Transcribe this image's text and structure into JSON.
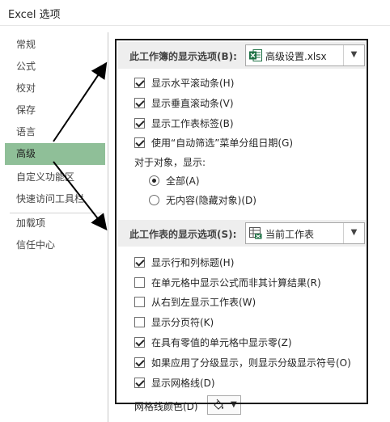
{
  "window": {
    "title": "Excel 选项"
  },
  "sidebar": {
    "items": [
      {
        "label": "常规"
      },
      {
        "label": "公式"
      },
      {
        "label": "校对"
      },
      {
        "label": "保存"
      },
      {
        "label": "语言"
      },
      {
        "label": "高级",
        "selected": true
      },
      {
        "label": "自定义功能区"
      },
      {
        "label": "快速访问工具栏"
      },
      {
        "label": "加载项"
      },
      {
        "label": "信任中心"
      }
    ]
  },
  "workbook_section": {
    "header": "此工作簿的显示选项(B):",
    "dropdown_value": "高级设置.xlsx",
    "file_icon": "excel-file-icon",
    "options": [
      {
        "label": "显示水平滚动条(H)",
        "checked": true
      },
      {
        "label": "显示垂直滚动条(V)",
        "checked": true
      },
      {
        "label": "显示工作表标签(B)",
        "checked": true
      },
      {
        "label": "使用“自动筛选”菜单分组日期(G)",
        "checked": true
      }
    ],
    "objects_label": "对于对象，显示:",
    "radios": [
      {
        "label": "全部(A)",
        "selected": true
      },
      {
        "label": "无内容(隐藏对象)(D)",
        "selected": false
      }
    ]
  },
  "sheet_section": {
    "header": "此工作表的显示选项(S):",
    "dropdown_value": "当前工作表",
    "sheet_icon": "worksheet-icon",
    "options": [
      {
        "label": "显示行和列标题(H)",
        "checked": true
      },
      {
        "label": "在单元格中显示公式而非其计算结果(R)",
        "checked": false
      },
      {
        "label": "从右到左显示工作表(W)",
        "checked": false
      },
      {
        "label": "显示分页符(K)",
        "checked": false
      },
      {
        "label": "在具有零值的单元格中显示零(Z)",
        "checked": true
      },
      {
        "label": "如果应用了分级显示，则显示分级显示符号(O)",
        "checked": true
      },
      {
        "label": "显示网格线(D)",
        "checked": true
      }
    ],
    "gridline_color_label": "网格线颜色(D)"
  },
  "colors": {
    "selected_nav": "#8fbf98",
    "section_header_bg": "#eeeeee",
    "excel_green": "#1e7145"
  }
}
